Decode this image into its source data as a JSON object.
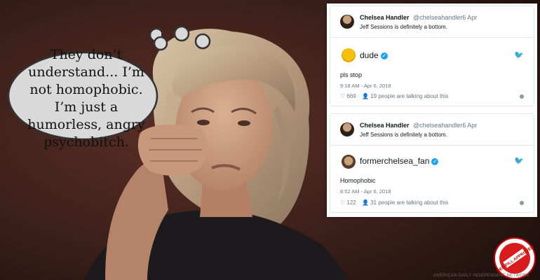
{
  "thought_bubble": {
    "text": "They don’t understand... I’m not homophobic. I’m just a humorless, angry psychobitch."
  },
  "tweet_1": {
    "quoted_name": "Chelsea Handler",
    "quoted_handle": "@chelseahandler",
    "quoted_date": "6 Apr",
    "quoted_text": "Jeff Sessions is definitely a bottom.",
    "user_name": "dude",
    "text": "pls stop",
    "time": "9:18 AM - Apr 6, 2018",
    "likes": "669",
    "talking": "19 people are talking about this"
  },
  "tweet_2": {
    "quoted_name": "Chelsea Handler",
    "quoted_handle": "@chelseahandler",
    "quoted_date": "6 Apr",
    "quoted_text": "Jeff Sessions is definitely a bottom.",
    "user_name": "formerchelsea_fan",
    "text": "Homophobic",
    "time": "8:52 AM - Apr 6, 2018",
    "likes": "122",
    "talking": "31 people are talking about this"
  },
  "seal_text": "RED PILL APPROVED",
  "watermark": "AMERICAN DAILY INDEPENDENT NETWORK",
  "icons": {
    "verified": "verified-badge-icon",
    "bird": "twitter-bird-icon",
    "heart": "heart-icon",
    "person": "person-icon",
    "info": "info-icon"
  }
}
